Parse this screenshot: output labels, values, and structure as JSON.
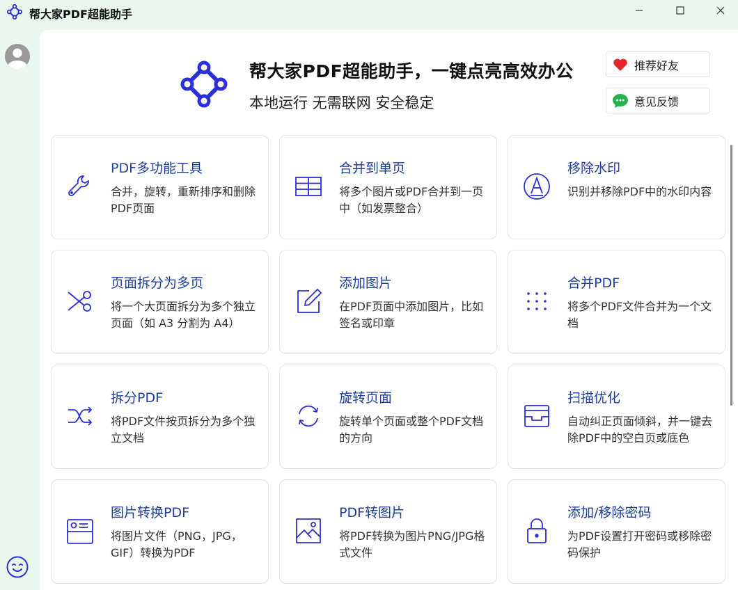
{
  "window": {
    "title": "帮大家PDF超能助手"
  },
  "hero": {
    "title": "帮大家PDF超能助手，一键点亮高效办公",
    "subtitle": "本地运行 无需联网 安全稳定"
  },
  "actions": {
    "recommend": "推荐好友",
    "feedback": "意见反馈"
  },
  "colors": {
    "accent": "#2b2fd6",
    "card_title": "#1e3fa0",
    "background": "#e9f7ef"
  },
  "tools": [
    {
      "icon": "wrench-icon",
      "title": "PDF多功能工具",
      "desc": "合并，旋转，重新排序和删除PDF页面"
    },
    {
      "icon": "table-icon",
      "title": "合并到单页",
      "desc": "将多个图片或PDF合并到一页中（如发票整合）"
    },
    {
      "icon": "watermark-icon",
      "title": "移除水印",
      "desc": "识别并移除PDF中的水印内容"
    },
    {
      "icon": "scissors-icon",
      "title": "页面拆分为多页",
      "desc": "将一个大页面拆分为多个独立页面（如 A3 分割为 A4）"
    },
    {
      "icon": "edit-icon",
      "title": "添加图片",
      "desc": "在PDF页面中添加图片，比如签名或印章"
    },
    {
      "icon": "grid-dots-icon",
      "title": "合并PDF",
      "desc": "将多个PDF文件合并为一个文档"
    },
    {
      "icon": "shuffle-icon",
      "title": "拆分PDF",
      "desc": "将PDF文件按页拆分为多个独立文档"
    },
    {
      "icon": "rotate-icon",
      "title": "旋转页面",
      "desc": "旋转单个页面或整个PDF文档的方向"
    },
    {
      "icon": "tray-icon",
      "title": "扫描优化",
      "desc": "自动纠正页面倾斜，并一键去除PDF中的空白页或底色"
    },
    {
      "icon": "id-card-icon",
      "title": "图片转换PDF",
      "desc": "将图片文件（PNG，JPG，GIF）转换为PDF"
    },
    {
      "icon": "image-icon",
      "title": "PDF转图片",
      "desc": "将PDF转换为图片PNG/JPG格式文件"
    },
    {
      "icon": "lock-icon",
      "title": "添加/移除密码",
      "desc": "为PDF设置打开密码或移除密码保护"
    }
  ]
}
